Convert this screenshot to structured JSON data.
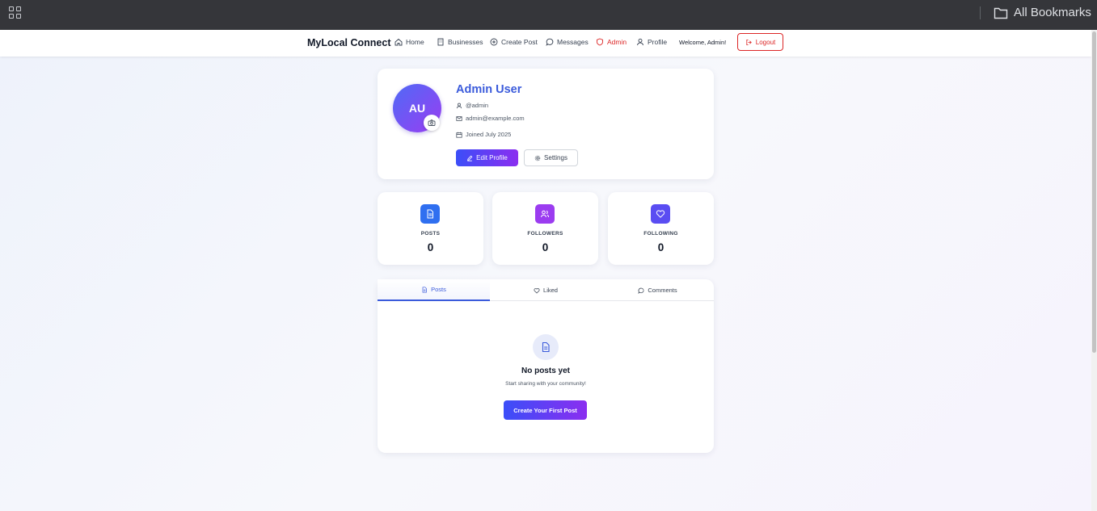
{
  "browser": {
    "bookmarks_folder": "All Bookmarks"
  },
  "navbar": {
    "brand": "MyLocal Connect",
    "items": [
      {
        "label": "Home",
        "icon": "home-icon"
      },
      {
        "label": "Businesses",
        "icon": "building-icon"
      },
      {
        "label": "Create Post",
        "icon": "plus-circle-icon"
      },
      {
        "label": "Messages",
        "icon": "message-icon"
      },
      {
        "label": "Admin",
        "icon": "shield-icon"
      },
      {
        "label": "Profile",
        "icon": "user-icon"
      }
    ],
    "welcome": "Welcome, Admin!",
    "logout": "Logout"
  },
  "profile": {
    "initials": "AU",
    "name": "Admin User",
    "username": "@admin",
    "email": "admin@example.com",
    "joined": "Joined July 2025",
    "edit_label": "Edit Profile",
    "settings_label": "Settings"
  },
  "stats": [
    {
      "label": "POSTS",
      "value": "0",
      "color": "#2f6ff0",
      "icon": "document-icon"
    },
    {
      "label": "FOLLOWERS",
      "value": "0",
      "color": "#9b3cf0",
      "icon": "users-icon"
    },
    {
      "label": "FOLLOWING",
      "value": "0",
      "color": "#5a4df2",
      "icon": "heart-icon"
    }
  ],
  "tabs": [
    {
      "label": "Posts",
      "icon": "document-icon"
    },
    {
      "label": "Liked",
      "icon": "heart-icon"
    },
    {
      "label": "Comments",
      "icon": "message-icon"
    }
  ],
  "empty_state": {
    "title": "No posts yet",
    "subtitle": "Start sharing with your community!",
    "button": "Create Your First Post"
  },
  "colors": {
    "accent": "#3b5bdb",
    "danger": "#dc2626",
    "gradient_start": "#3b4ef8",
    "gradient_end": "#8b2ef0"
  }
}
